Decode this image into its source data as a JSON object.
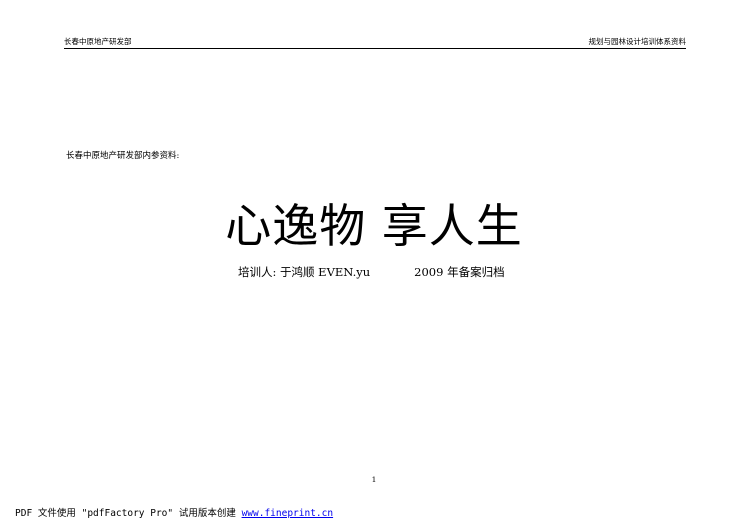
{
  "header": {
    "left": "长春中原地产研发部",
    "right": "规划与园林设计培训体系资料"
  },
  "intro": "长春中原地产研发部内参资料:",
  "title": "心逸物  享人生",
  "subtitle": {
    "trainer": "培训人:  于鸿顺  EVEN.yu",
    "archive": "2009 年备案归档"
  },
  "page_number": "1",
  "footer": {
    "text": "PDF 文件使用 \"pdfFactory Pro\" 试用版本创建 ",
    "link": "www.fineprint.cn"
  }
}
